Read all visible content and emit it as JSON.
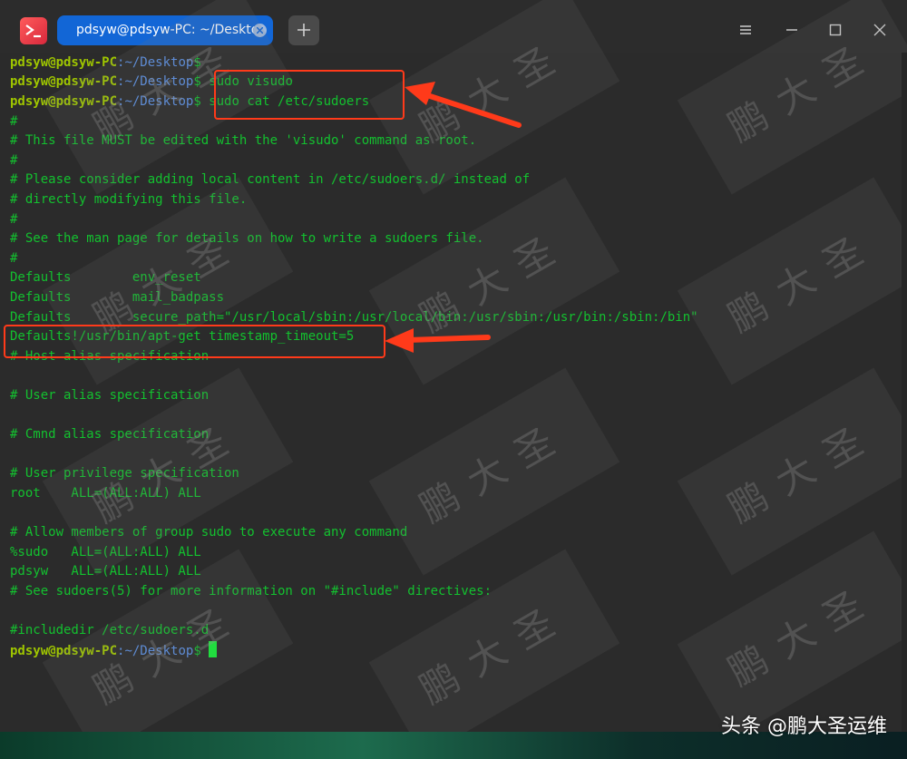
{
  "tab": {
    "title": "pdsyw@pdsyw-PC: ~/Desktop"
  },
  "prompt": {
    "user": "pdsyw@pdsyw-PC",
    "path": ":~/Desktop",
    "sign": "$ "
  },
  "commands": [
    "sudo visudo",
    "sudo cat /etc/sudoers"
  ],
  "output": [
    "#",
    "# This file MUST be edited with the 'visudo' command as root.",
    "#",
    "# Please consider adding local content in /etc/sudoers.d/ instead of",
    "# directly modifying this file.",
    "#",
    "# See the man page for details on how to write a sudoers file.",
    "#",
    "Defaults        env_reset",
    "Defaults        mail_badpass",
    "Defaults        secure_path=\"/usr/local/sbin:/usr/local/bin:/usr/sbin:/usr/bin:/sbin:/bin\"",
    "Defaults!/usr/bin/apt-get timestamp_timeout=5",
    "# Host alias specification",
    "",
    "# User alias specification",
    "",
    "# Cmnd alias specification",
    "",
    "# User privilege specification",
    "root    ALL=(ALL:ALL) ALL",
    "",
    "# Allow members of group sudo to execute any command",
    "%sudo   ALL=(ALL:ALL) ALL",
    "pdsyw   ALL=(ALL:ALL) ALL",
    "# See sudoers(5) for more information on \"#include\" directives:",
    "",
    "#includedir /etc/sudoers.d"
  ],
  "watermark": {
    "text": "鹏大圣"
  },
  "brand": {
    "text": "头条 @鹏大圣运维"
  },
  "colors": {
    "prompt_user": "#9fc600",
    "prompt_path": "#5a8fe2",
    "text": "#13c12f",
    "annotation": "#ff3a1a",
    "tab_active": "#1266d6"
  },
  "icons": [
    "terminal-icon",
    "plus-icon",
    "close-icon",
    "menu-icon",
    "minimize-icon",
    "maximize-icon",
    "window-close-icon"
  ]
}
